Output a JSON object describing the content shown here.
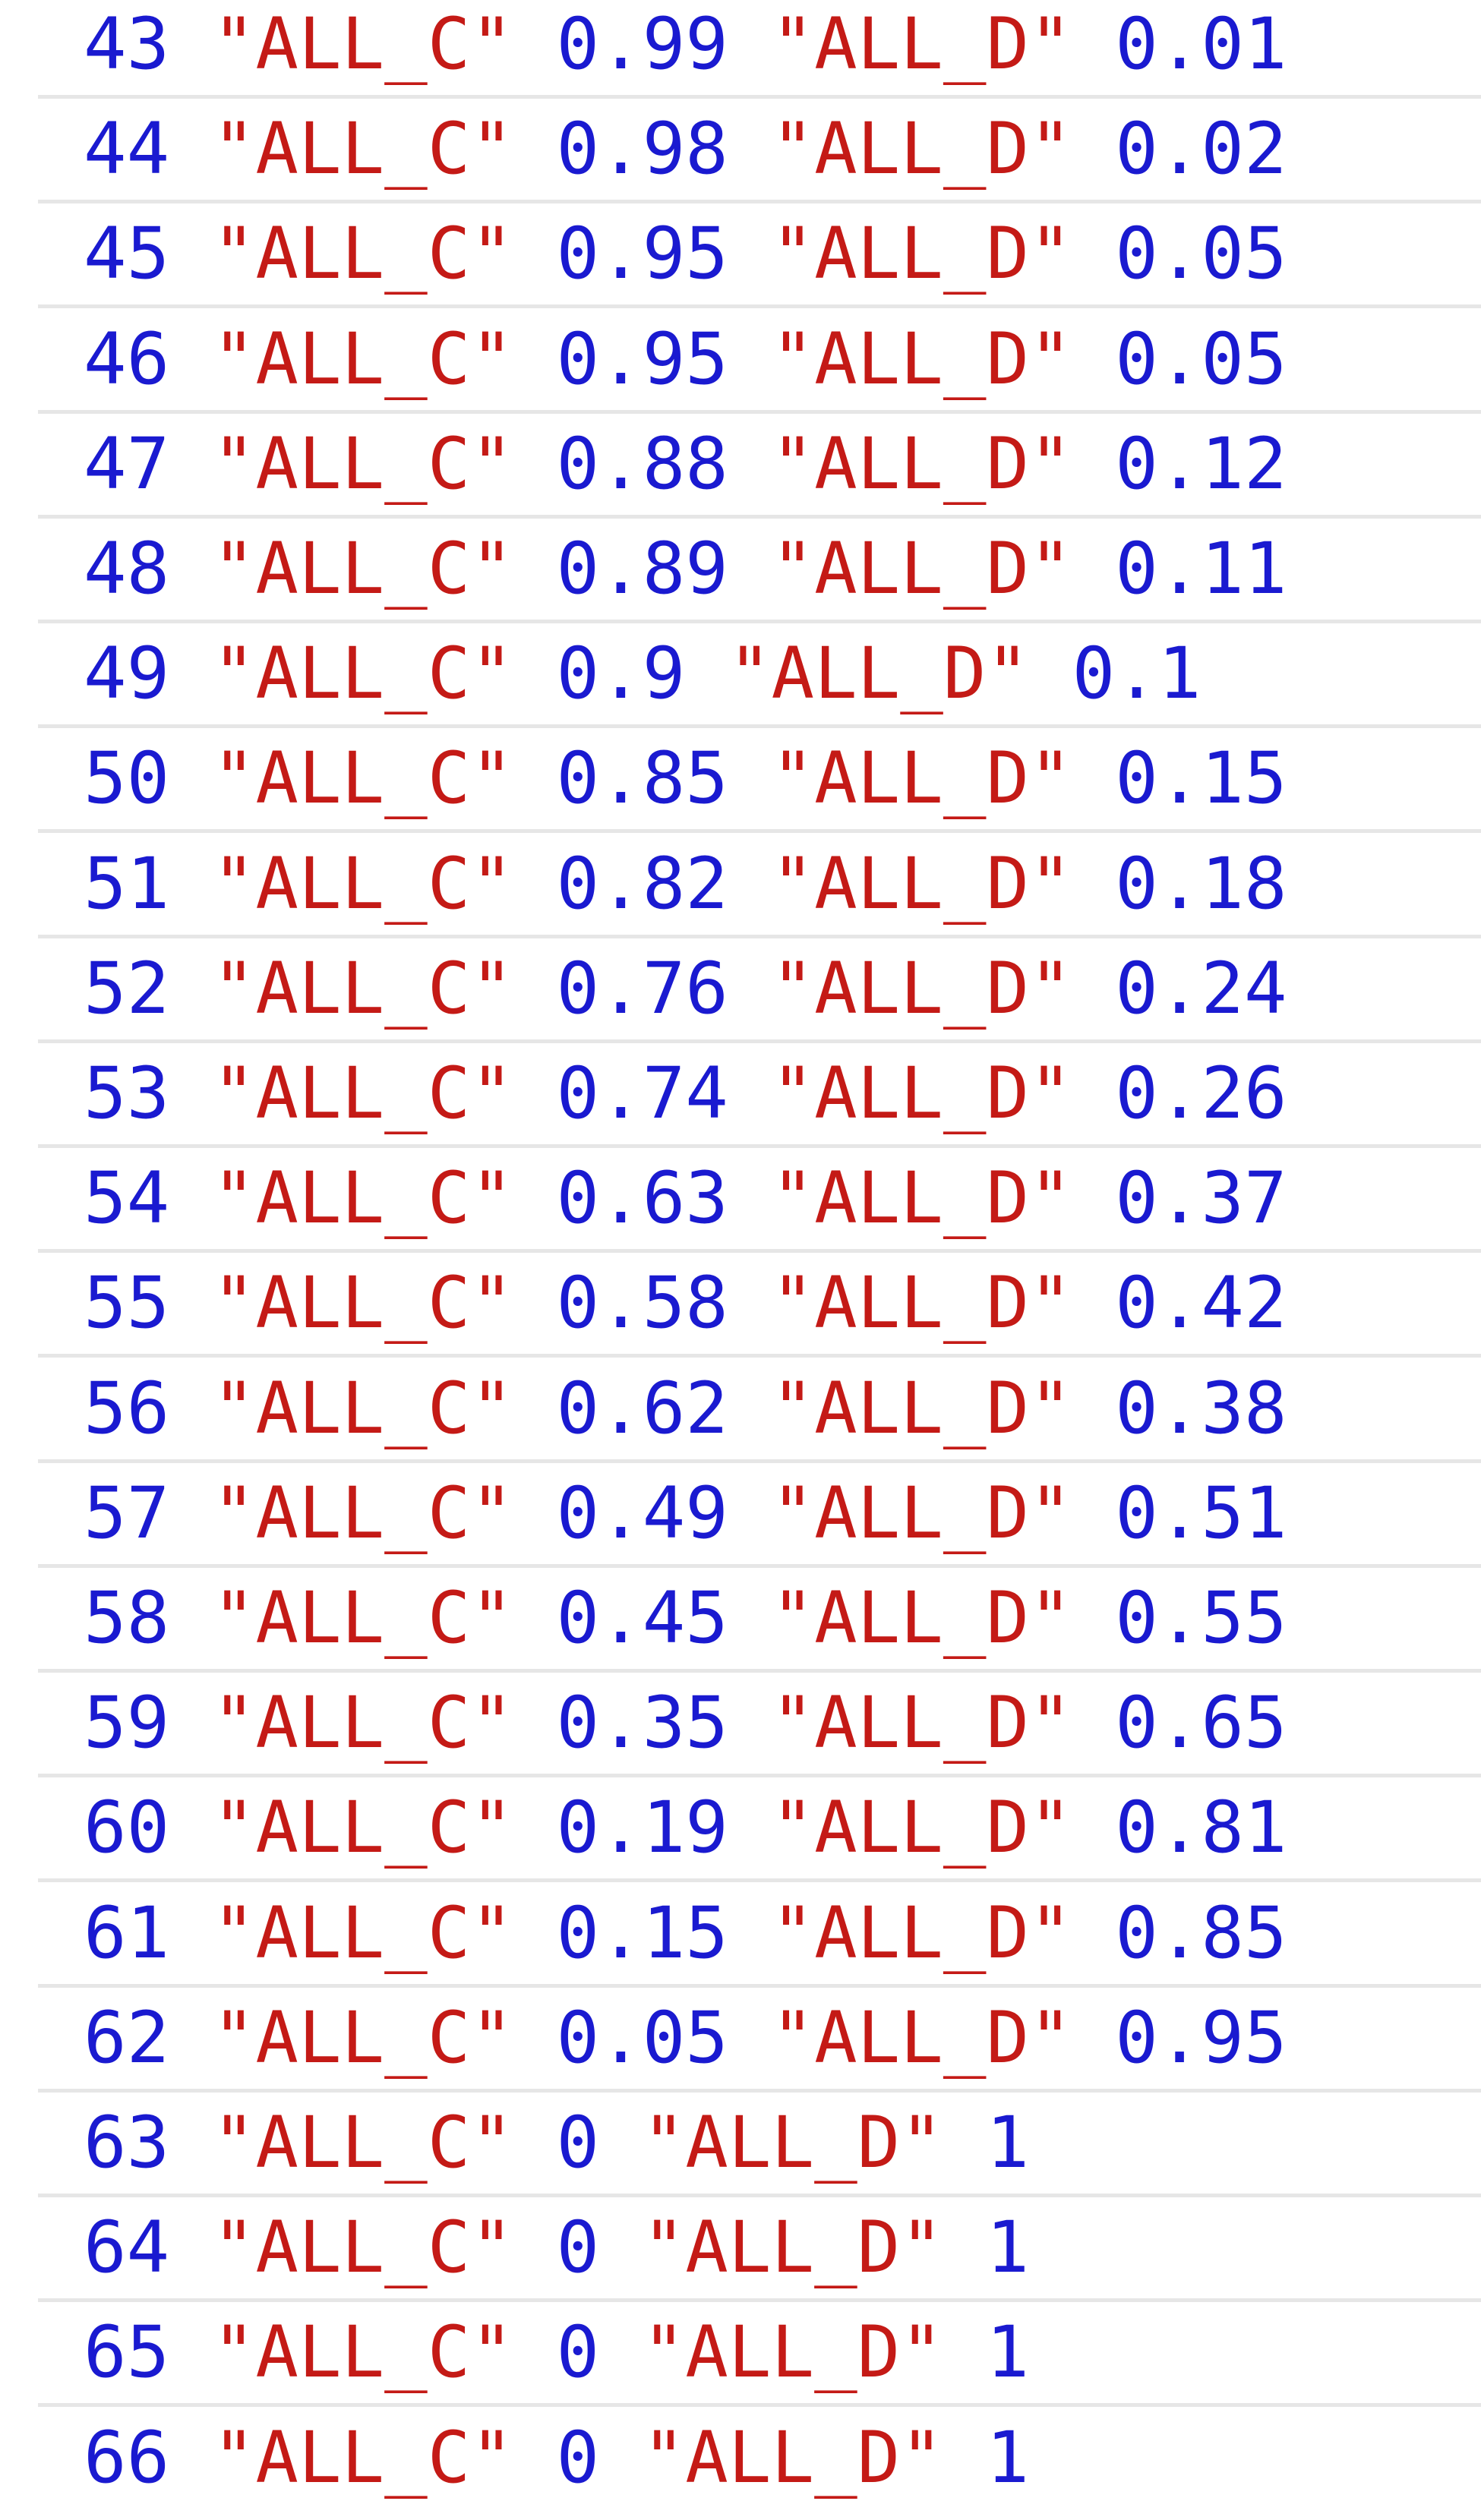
{
  "colors": {
    "number": "#1a1ad0",
    "string": "#c41a16",
    "row_divider": "#e6e6e6",
    "background": "#ffffff"
  },
  "rows": [
    {
      "index": "43",
      "key_a": "\"ALL_C\"",
      "val_a": "0.99",
      "key_b": "\"ALL_D\"",
      "val_b": "0.01"
    },
    {
      "index": "44",
      "key_a": "\"ALL_C\"",
      "val_a": "0.98",
      "key_b": "\"ALL_D\"",
      "val_b": "0.02"
    },
    {
      "index": "45",
      "key_a": "\"ALL_C\"",
      "val_a": "0.95",
      "key_b": "\"ALL_D\"",
      "val_b": "0.05"
    },
    {
      "index": "46",
      "key_a": "\"ALL_C\"",
      "val_a": "0.95",
      "key_b": "\"ALL_D\"",
      "val_b": "0.05"
    },
    {
      "index": "47",
      "key_a": "\"ALL_C\"",
      "val_a": "0.88",
      "key_b": "\"ALL_D\"",
      "val_b": "0.12"
    },
    {
      "index": "48",
      "key_a": "\"ALL_C\"",
      "val_a": "0.89",
      "key_b": "\"ALL_D\"",
      "val_b": "0.11"
    },
    {
      "index": "49",
      "key_a": "\"ALL_C\"",
      "val_a": "0.9",
      "key_b": "\"ALL_D\"",
      "val_b": "0.1"
    },
    {
      "index": "50",
      "key_a": "\"ALL_C\"",
      "val_a": "0.85",
      "key_b": "\"ALL_D\"",
      "val_b": "0.15"
    },
    {
      "index": "51",
      "key_a": "\"ALL_C\"",
      "val_a": "0.82",
      "key_b": "\"ALL_D\"",
      "val_b": "0.18"
    },
    {
      "index": "52",
      "key_a": "\"ALL_C\"",
      "val_a": "0.76",
      "key_b": "\"ALL_D\"",
      "val_b": "0.24"
    },
    {
      "index": "53",
      "key_a": "\"ALL_C\"",
      "val_a": "0.74",
      "key_b": "\"ALL_D\"",
      "val_b": "0.26"
    },
    {
      "index": "54",
      "key_a": "\"ALL_C\"",
      "val_a": "0.63",
      "key_b": "\"ALL_D\"",
      "val_b": "0.37"
    },
    {
      "index": "55",
      "key_a": "\"ALL_C\"",
      "val_a": "0.58",
      "key_b": "\"ALL_D\"",
      "val_b": "0.42"
    },
    {
      "index": "56",
      "key_a": "\"ALL_C\"",
      "val_a": "0.62",
      "key_b": "\"ALL_D\"",
      "val_b": "0.38"
    },
    {
      "index": "57",
      "key_a": "\"ALL_C\"",
      "val_a": "0.49",
      "key_b": "\"ALL_D\"",
      "val_b": "0.51"
    },
    {
      "index": "58",
      "key_a": "\"ALL_C\"",
      "val_a": "0.45",
      "key_b": "\"ALL_D\"",
      "val_b": "0.55"
    },
    {
      "index": "59",
      "key_a": "\"ALL_C\"",
      "val_a": "0.35",
      "key_b": "\"ALL_D\"",
      "val_b": "0.65"
    },
    {
      "index": "60",
      "key_a": "\"ALL_C\"",
      "val_a": "0.19",
      "key_b": "\"ALL_D\"",
      "val_b": "0.81"
    },
    {
      "index": "61",
      "key_a": "\"ALL_C\"",
      "val_a": "0.15",
      "key_b": "\"ALL_D\"",
      "val_b": "0.85"
    },
    {
      "index": "62",
      "key_a": "\"ALL_C\"",
      "val_a": "0.05",
      "key_b": "\"ALL_D\"",
      "val_b": "0.95"
    },
    {
      "index": "63",
      "key_a": "\"ALL_C\"",
      "val_a": "0",
      "key_b": "\"ALL_D\"",
      "val_b": "1"
    },
    {
      "index": "64",
      "key_a": "\"ALL_C\"",
      "val_a": "0",
      "key_b": "\"ALL_D\"",
      "val_b": "1"
    },
    {
      "index": "65",
      "key_a": "\"ALL_C\"",
      "val_a": "0",
      "key_b": "\"ALL_D\"",
      "val_b": "1"
    },
    {
      "index": "66",
      "key_a": "\"ALL_C\"",
      "val_a": "0",
      "key_b": "\"ALL_D\"",
      "val_b": "1"
    }
  ]
}
